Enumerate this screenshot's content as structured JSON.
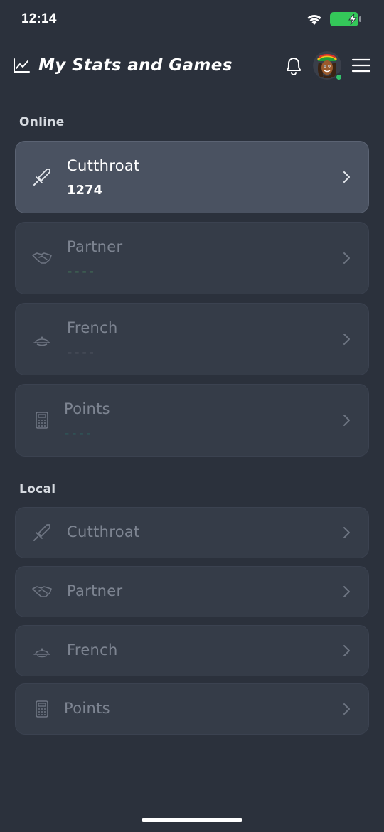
{
  "status": {
    "time": "12:14"
  },
  "header": {
    "title": "My Stats and Games"
  },
  "sections": {
    "online": {
      "label": "Online",
      "items": [
        {
          "name": "Cutthroat",
          "value": "1274",
          "icon": "sword-icon"
        },
        {
          "name": "Partner",
          "value": "----",
          "icon": "handshake-icon",
          "dash_color": "#3f6a55"
        },
        {
          "name": "French",
          "value": "----",
          "icon": "dish-icon",
          "dash_color": "#4a505c"
        },
        {
          "name": "Points",
          "value": "----",
          "icon": "calculator-icon",
          "dash_color": "#2d5a5c"
        }
      ]
    },
    "local": {
      "label": "Local",
      "items": [
        {
          "name": "Cutthroat",
          "icon": "sword-icon"
        },
        {
          "name": "Partner",
          "icon": "handshake-icon"
        },
        {
          "name": "French",
          "icon": "dish-icon"
        },
        {
          "name": "Points",
          "icon": "calculator-icon"
        }
      ]
    }
  },
  "colors": {
    "background": "#2b313c",
    "card": "#353c48",
    "card_active": "#4a5261",
    "online_dot": "#32c26b",
    "battery": "#34c759"
  }
}
